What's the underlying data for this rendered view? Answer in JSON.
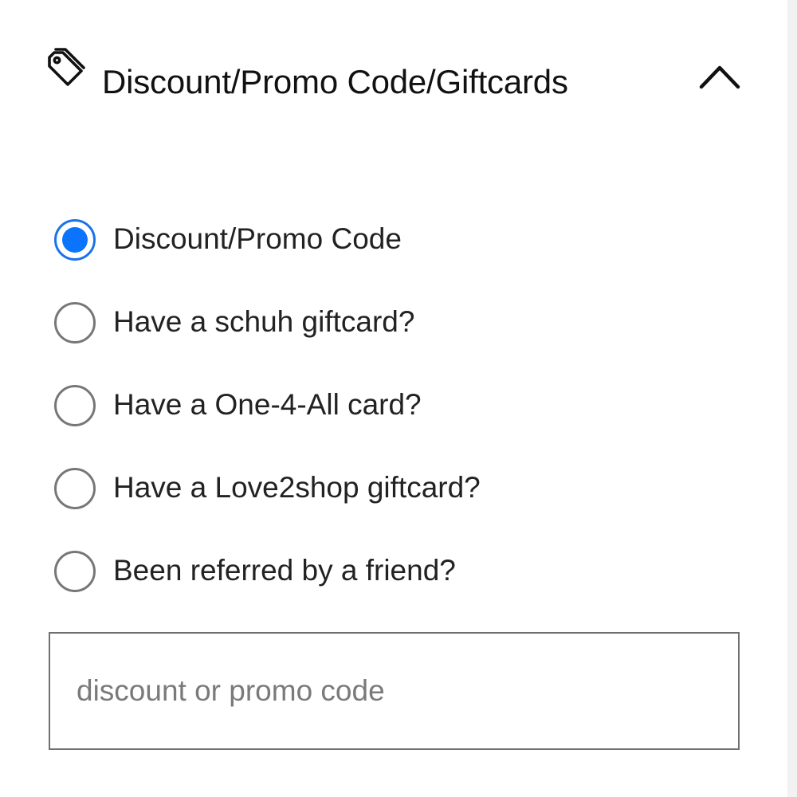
{
  "panel": {
    "title": "Discount/Promo Code/Giftcards",
    "tag_icon": "tag-icon",
    "collapse_icon": "chevron-up-icon",
    "expanded": true
  },
  "options": {
    "items": [
      {
        "label": "Discount/Promo Code",
        "checked": true
      },
      {
        "label": "Have a schuh giftcard?",
        "checked": false
      },
      {
        "label": "Have a One-4-All card?",
        "checked": false
      },
      {
        "label": "Have a Love2shop giftcard?",
        "checked": false
      },
      {
        "label": "Been referred by a friend?",
        "checked": false
      }
    ]
  },
  "code_input": {
    "value": "",
    "placeholder": "discount or promo code"
  },
  "colors": {
    "accent": "#0b74ff",
    "text": "#222222",
    "border": "#6f6f6f",
    "placeholder": "#7a7a7a"
  }
}
